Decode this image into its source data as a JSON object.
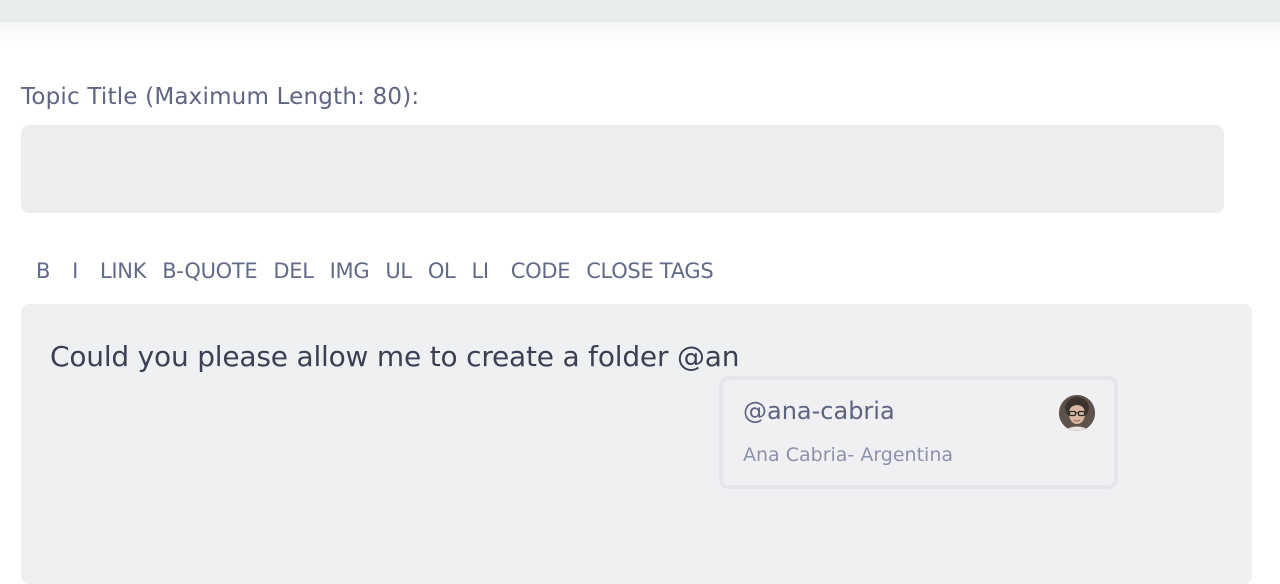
{
  "form": {
    "title_label": "Topic Title (Maximum Length: 80):",
    "title_value": ""
  },
  "toolbar": {
    "buttons": [
      "B",
      "I",
      "LINK",
      "B-QUOTE",
      "DEL",
      "IMG",
      "UL",
      "OL",
      "LI",
      "CODE",
      "CLOSE TAGS"
    ]
  },
  "editor": {
    "text": "Could you please allow me to create a folder @an"
  },
  "mention": {
    "handle": "@ana-cabria",
    "name": "Ana Cabria- Argentina",
    "avatar_icon": "user-avatar"
  }
}
